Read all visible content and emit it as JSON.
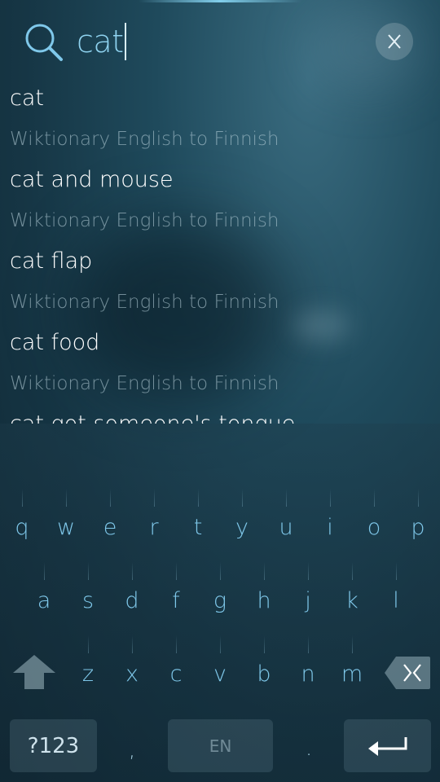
{
  "search": {
    "query": "cat"
  },
  "results": [
    {
      "word": "cat",
      "source": "Wiktionary English to Finnish"
    },
    {
      "word": "cat and mouse",
      "source": "Wiktionary English to Finnish"
    },
    {
      "word": "cat flap",
      "source": "Wiktionary English to Finnish"
    },
    {
      "word": "cat food",
      "source": "Wiktionary English to Finnish"
    },
    {
      "word": "cat got someone's tongue",
      "source": ""
    }
  ],
  "keyboard": {
    "row1": [
      "q",
      "w",
      "e",
      "r",
      "t",
      "y",
      "u",
      "i",
      "o",
      "p"
    ],
    "row2": [
      "a",
      "s",
      "d",
      "f",
      "g",
      "h",
      "j",
      "k",
      "l"
    ],
    "row3": [
      "z",
      "x",
      "c",
      "v",
      "b",
      "n",
      "m"
    ],
    "symbols_label": "?123",
    "comma_label": ",",
    "space_label": "EN",
    "period_label": ".",
    "icons": {
      "shift": "shift-arrow-icon",
      "backspace": "backspace-icon",
      "enter": "enter-arrow-icon"
    }
  },
  "colors": {
    "accent": "#7fc8ea",
    "query": "#8fd3f0"
  }
}
